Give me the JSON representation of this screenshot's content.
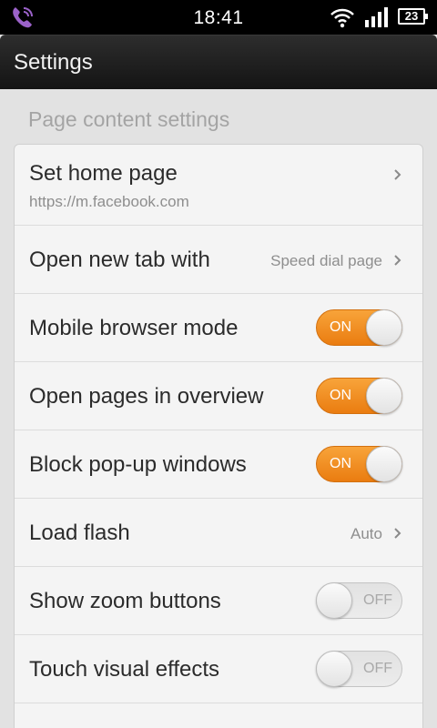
{
  "status_bar": {
    "time": "18:41",
    "battery": "23",
    "icons": [
      "viber-icon",
      "wifi-icon",
      "signal-icon",
      "battery-icon"
    ]
  },
  "title_bar": {
    "title": "Settings"
  },
  "section": {
    "header": "Page content settings",
    "rows": [
      {
        "label": "Set home page",
        "subtitle": "https://m.facebook.com",
        "type": "link"
      },
      {
        "label": "Open new tab with",
        "value": "Speed dial page",
        "type": "link"
      },
      {
        "label": "Mobile browser mode",
        "toggle": "ON",
        "state": true,
        "type": "toggle"
      },
      {
        "label": "Open pages in overview",
        "toggle": "ON",
        "state": true,
        "type": "toggle"
      },
      {
        "label": "Block pop-up windows",
        "toggle": "ON",
        "state": true,
        "type": "toggle"
      },
      {
        "label": "Load flash",
        "value": "Auto",
        "type": "link"
      },
      {
        "label": "Show zoom buttons",
        "toggle": "OFF",
        "state": false,
        "type": "toggle"
      },
      {
        "label": "Touch visual effects",
        "toggle": "OFF",
        "state": false,
        "type": "toggle"
      }
    ]
  },
  "colors": {
    "accent": "#f0901f",
    "title_bar": "#1e1e1e",
    "background": "#e2e2e2"
  }
}
